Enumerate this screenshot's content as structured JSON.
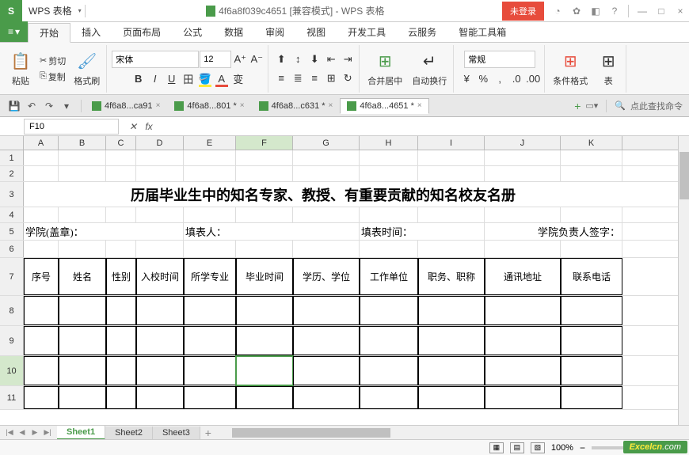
{
  "app": {
    "name": "WPS 表格",
    "doc_title": "4f6a8f039c4651 [兼容模式] - WPS 表格",
    "login": "未登录"
  },
  "ribbon_tabs": [
    "开始",
    "插入",
    "页面布局",
    "公式",
    "数据",
    "审阅",
    "视图",
    "开发工具",
    "云服务",
    "智能工具箱"
  ],
  "file_menu": "▾",
  "clipboard": {
    "paste": "粘贴",
    "cut": "剪切",
    "copy": "复制",
    "format_painter": "格式刷"
  },
  "font": {
    "name": "宋体",
    "size": "12",
    "increase": "A⁺",
    "decrease": "A⁻"
  },
  "align": {
    "merge": "合并居中",
    "wrap": "自动换行"
  },
  "number": {
    "format": "常规"
  },
  "styles": {
    "cond": "条件格式",
    "table": "表"
  },
  "doc_tabs": [
    {
      "label": "4f6a8...ca91",
      "close": "×"
    },
    {
      "label": "4f6a8...801 *",
      "close": "×"
    },
    {
      "label": "4f6a8...c631 *",
      "close": "×"
    },
    {
      "label": "4f6a8...4651 *",
      "close": "×"
    }
  ],
  "search_hint": "点此查找命令",
  "name_box": "F10",
  "fx": "fx",
  "columns": [
    "A",
    "B",
    "C",
    "D",
    "E",
    "F",
    "G",
    "H",
    "I",
    "J",
    "K"
  ],
  "rows": [
    "1",
    "2",
    "3",
    "4",
    "5",
    "6",
    "7",
    "8",
    "9",
    "10",
    "11"
  ],
  "sheet": {
    "title": "历届毕业生中的知名专家、教授、有重要贡献的知名校友名册",
    "labels": {
      "college": "学院(盖章)：",
      "filler": "填表人：",
      "fill_time": "填表时间：",
      "head_sign": "学院负责人签字："
    },
    "headers": [
      "序号",
      "姓名",
      "性别",
      "入校时间",
      "所学专业",
      "毕业时间",
      "学历、学位",
      "工作单位",
      "职务、职称",
      "通讯地址",
      "联系电话"
    ]
  },
  "sheet_tabs": [
    "Sheet1",
    "Sheet2",
    "Sheet3"
  ],
  "zoom": "100%",
  "watermark": {
    "brand": "Excelcn",
    "suffix": ".com"
  }
}
